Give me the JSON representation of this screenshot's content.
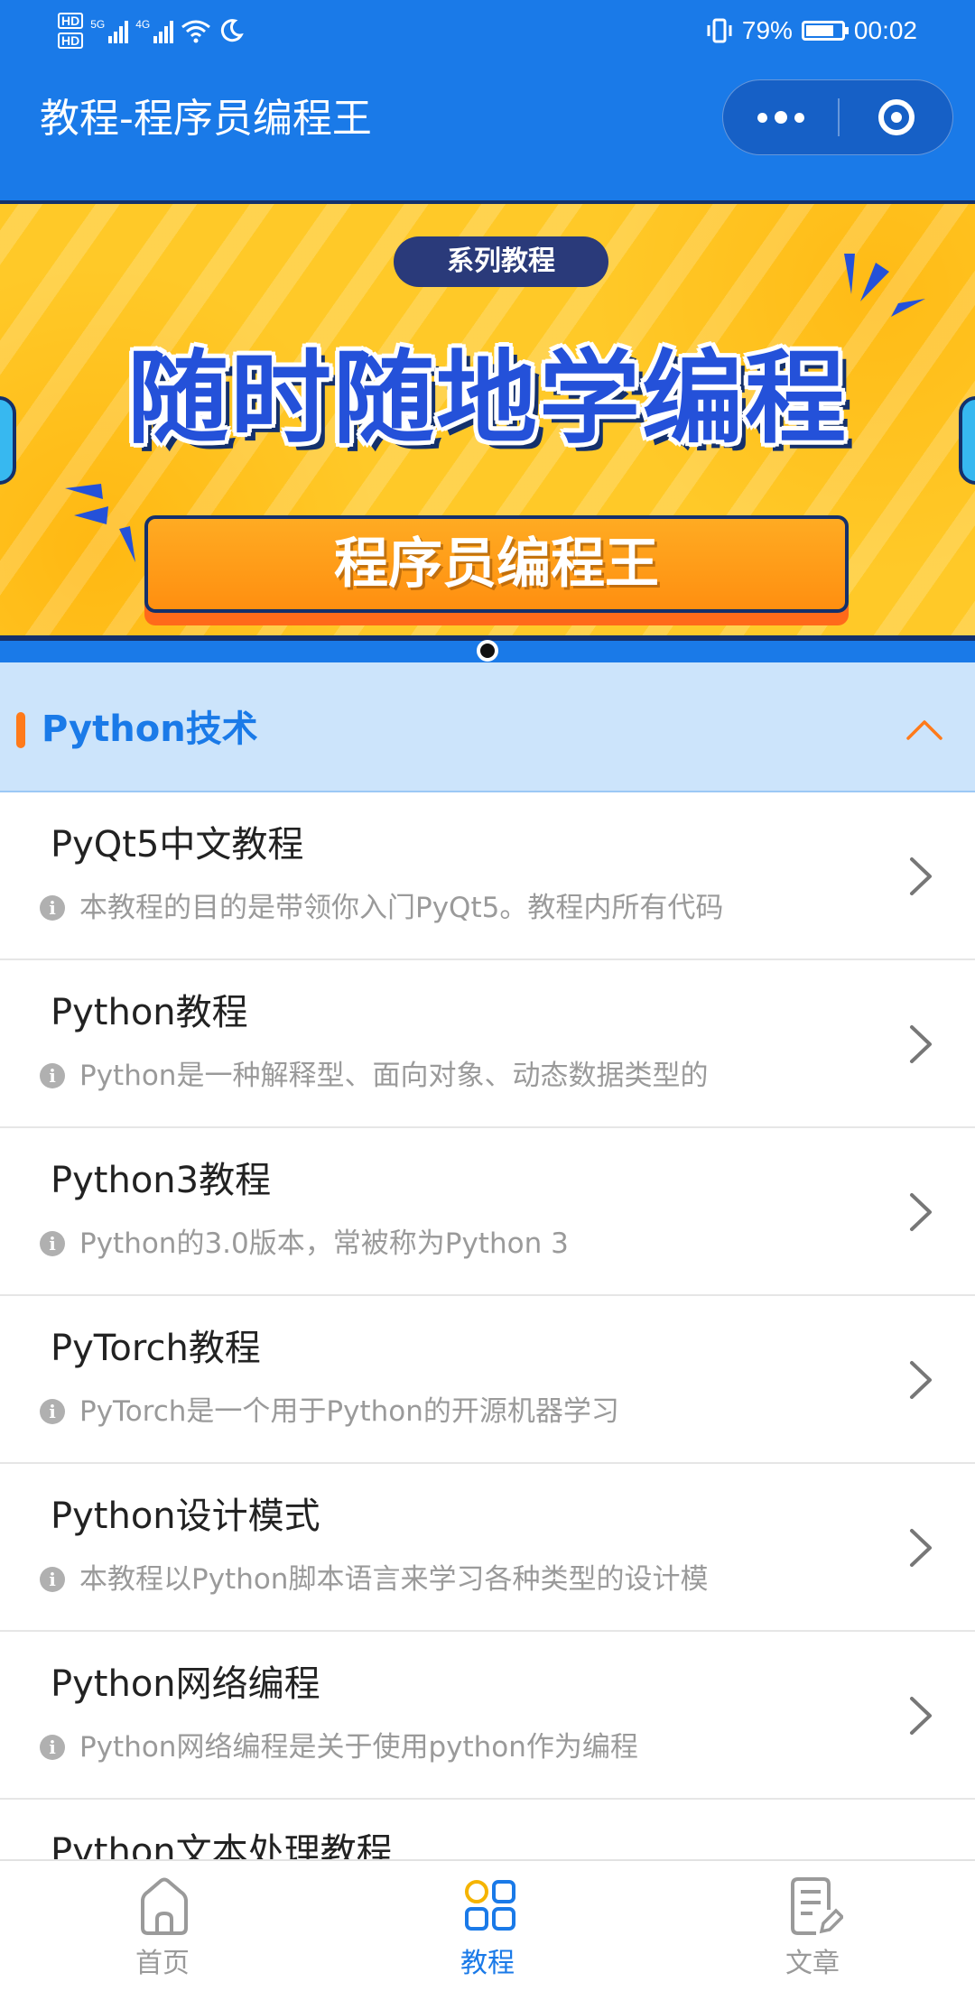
{
  "status_bar": {
    "hd1": "HD",
    "hd2": "HD",
    "net1": "5G",
    "net2": "4G",
    "battery_percent": "79%",
    "battery_level": 0.79,
    "time": "00:02"
  },
  "nav": {
    "title": "教程-程序员编程王"
  },
  "banner": {
    "tag": "系列教程",
    "headline": "随时随地学编程",
    "button_text": "程序员编程王"
  },
  "section": {
    "title": "Python技术"
  },
  "list": [
    {
      "title": "PyQt5中文教程",
      "desc": "本教程的目的是带领你入门PyQt5。教程内所有代码"
    },
    {
      "title": "Python教程",
      "desc": "Python是一种解释型、面向对象、动态数据类型的"
    },
    {
      "title": "Python3教程",
      "desc": "Python的3.0版本，常被称为Python 3"
    },
    {
      "title": "PyTorch教程",
      "desc": "PyTorch是一个用于Python的开源机器学习"
    },
    {
      "title": "Python设计模式",
      "desc": "本教程以Python脚本语言来学习各种类型的设计模"
    },
    {
      "title": "Python网络编程",
      "desc": "Python网络编程是关于使用python作为编程"
    },
    {
      "title": "Python文本处理教程",
      "desc": ""
    }
  ],
  "tabbar": {
    "home": "首页",
    "tutorials": "教程",
    "articles": "文章"
  },
  "colors": {
    "primary": "#1a7ae8",
    "accent": "#ff7a1a"
  },
  "icons": {
    "home": "home-icon",
    "tutorials": "grid-icon",
    "articles": "article-edit-icon"
  }
}
